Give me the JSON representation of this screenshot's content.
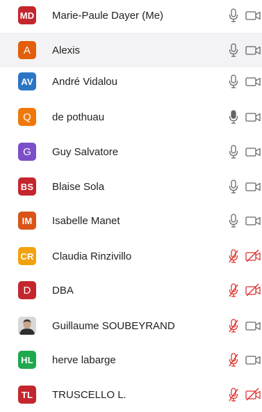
{
  "participants": [
    {
      "initials": "MD",
      "name": "Marie-Paule Dayer (Me)",
      "color": "#c4262e",
      "mic": "on",
      "video": "off",
      "highlight": false,
      "photo": false
    },
    {
      "initials": "A",
      "name": "Alexis",
      "color": "#e15f0d",
      "mic": "on",
      "video": "off",
      "highlight": true,
      "photo": false
    },
    {
      "initials": "AV",
      "name": "André Vidalou",
      "color": "#2b76c4",
      "mic": "on",
      "video": "off",
      "highlight": false,
      "photo": false
    },
    {
      "initials": "Q",
      "name": "de pothuau",
      "color": "#f0780a",
      "mic": "speaking",
      "video": "off",
      "highlight": false,
      "photo": false
    },
    {
      "initials": "G",
      "name": "Guy Salvatore",
      "color": "#7b4fc9",
      "mic": "on",
      "video": "off",
      "highlight": false,
      "photo": false
    },
    {
      "initials": "BS",
      "name": "Blaise Sola",
      "color": "#c4262e",
      "mic": "on",
      "video": "off",
      "highlight": false,
      "photo": false
    },
    {
      "initials": "IM",
      "name": "Isabelle Manet",
      "color": "#d9541a",
      "mic": "on",
      "video": "off",
      "highlight": false,
      "photo": false
    },
    {
      "initials": "CR",
      "name": "Claudia Rinzivillo",
      "color": "#f2a20d",
      "mic": "muted",
      "video": "muted",
      "highlight": false,
      "photo": false
    },
    {
      "initials": "D",
      "name": "DBA",
      "color": "#c4262e",
      "mic": "muted",
      "video": "muted",
      "highlight": false,
      "photo": false
    },
    {
      "initials": "",
      "name": "Guillaume SOUBEYRAND",
      "color": "#dcdcdc",
      "mic": "muted",
      "video": "off",
      "highlight": false,
      "photo": true
    },
    {
      "initials": "HL",
      "name": "herve labarge",
      "color": "#1fa84e",
      "mic": "muted",
      "video": "off",
      "highlight": false,
      "photo": false
    },
    {
      "initials": "TL",
      "name": "TRUSCELLO L.",
      "color": "#c4262e",
      "mic": "muted",
      "video": "muted",
      "highlight": false,
      "photo": false
    }
  ],
  "icons": {
    "mic": "microphone-icon",
    "mic_muted": "microphone-muted-icon",
    "camera": "video-camera-icon",
    "camera_muted": "video-camera-muted-icon"
  },
  "colors": {
    "muted": "#e0312f",
    "icon": "#666666"
  }
}
